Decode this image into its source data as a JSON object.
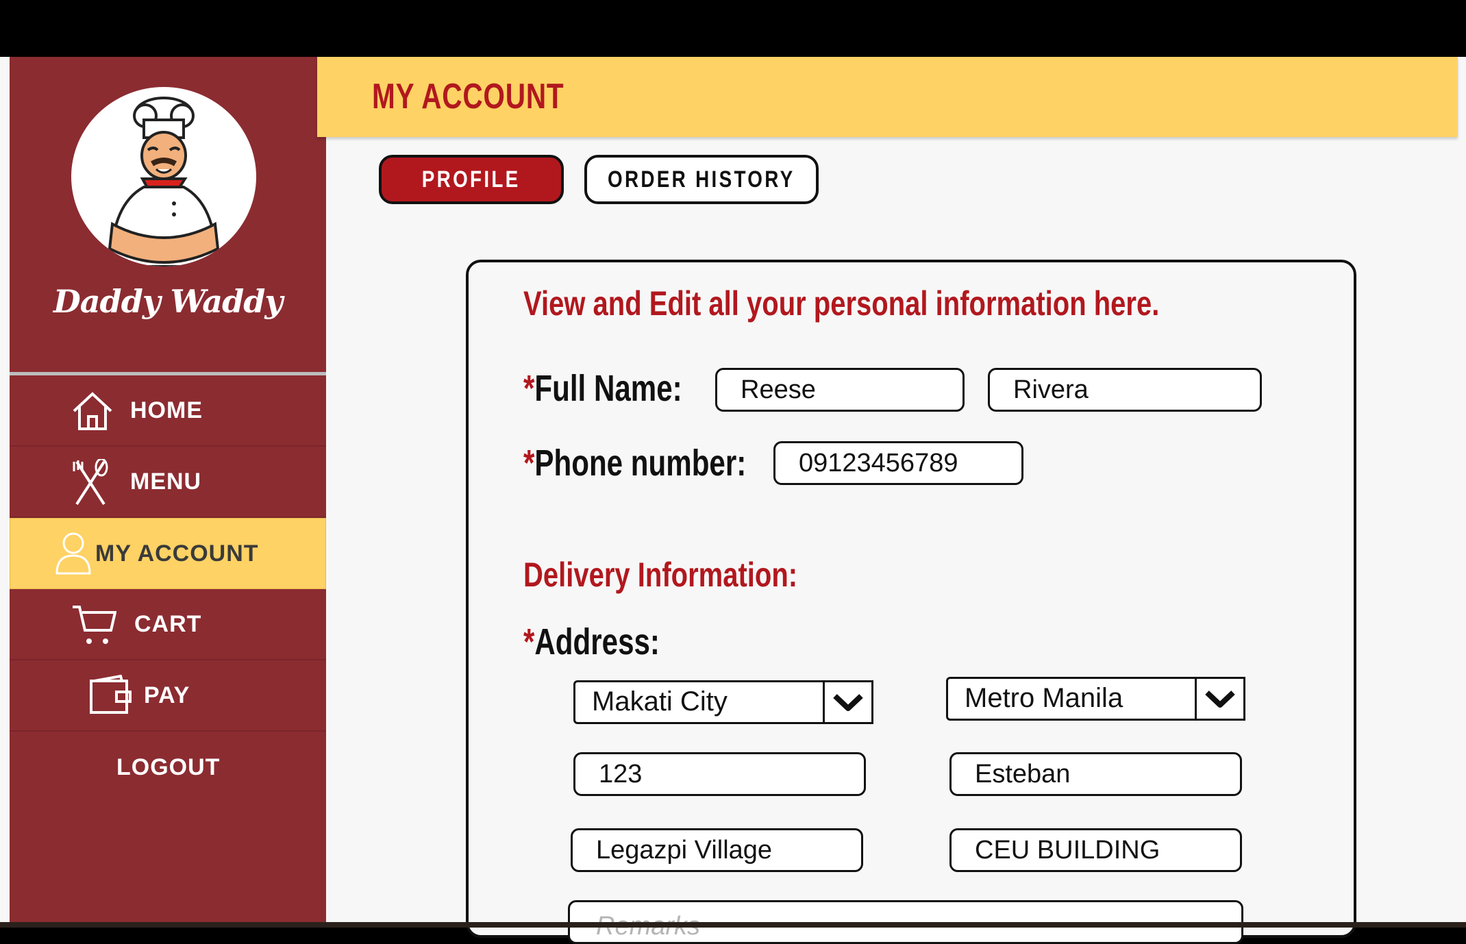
{
  "brand": {
    "name": "Daddy Waddy"
  },
  "sidebar": {
    "items": [
      {
        "label": "HOME",
        "icon": "home-icon"
      },
      {
        "label": "MENU",
        "icon": "utensils-icon"
      },
      {
        "label": "MY ACCOUNT",
        "icon": "user-icon",
        "active": true
      },
      {
        "label": "CART",
        "icon": "cart-icon"
      },
      {
        "label": "PAY",
        "icon": "wallet-icon"
      },
      {
        "label": "LOGOUT"
      }
    ]
  },
  "header": {
    "title": "MY ACCOUNT"
  },
  "tabs": [
    {
      "label": "PROFILE",
      "active": true
    },
    {
      "label": "ORDER HISTORY",
      "active": false
    }
  ],
  "profile": {
    "intro": "View and Edit all your personal information here.",
    "full_name_label": "Full Name:",
    "first_name": "Reese",
    "last_name": "Rivera",
    "phone_label": "Phone number:",
    "phone": "09123456789",
    "required_mark": "*"
  },
  "delivery": {
    "heading": "Delivery Information:",
    "address_label": "Address:",
    "city": "Makati City",
    "region": "Metro Manila",
    "house_number": "123",
    "street": "Esteban",
    "barangay": "Legazpi Village",
    "building": "CEU BUILDING",
    "remarks_placeholder": "Remarks"
  },
  "colors": {
    "sidebar": "#8b2c31",
    "accent_yellow": "#fed264",
    "accent_red": "#b1181e",
    "background": "#f7f7f7"
  }
}
